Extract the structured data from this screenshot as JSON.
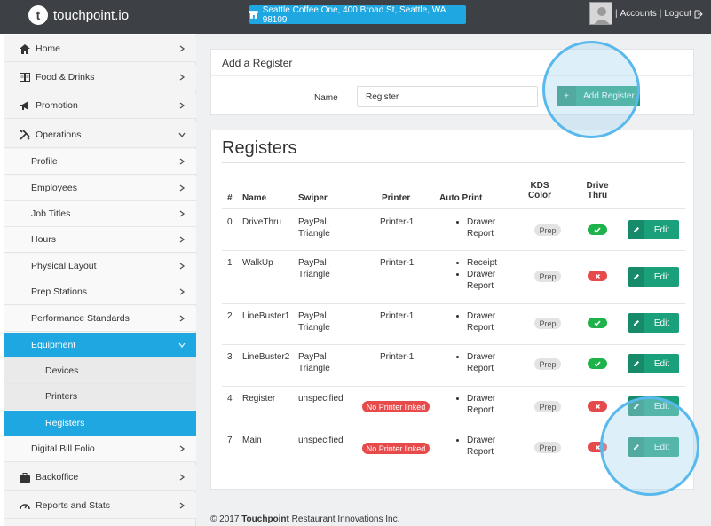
{
  "topbar": {
    "logo_text": "touchpoint.io",
    "logo_letter": "t",
    "store_label": "Seattle Coffee One, 400 Broad St, Seattle, WA 98109",
    "accounts_label": "Accounts",
    "logout_label": "Logout",
    "separator": "|"
  },
  "sidebar": {
    "home": "Home",
    "food": "Food & Drinks",
    "promotion": "Promotion",
    "operations": "Operations",
    "profile": "Profile",
    "employees": "Employees",
    "job_titles": "Job Titles",
    "hours": "Hours",
    "physical_layout": "Physical Layout",
    "prep_stations": "Prep Stations",
    "performance_standards": "Performance Standards",
    "equipment": "Equipment",
    "devices": "Devices",
    "printers": "Printers",
    "registers": "Registers",
    "digital_bill_folio": "Digital Bill Folio",
    "backoffice": "Backoffice",
    "reports": "Reports and Stats"
  },
  "add_register": {
    "heading": "Add a Register",
    "name_label": "Name",
    "name_value": "Register",
    "button_label": "Add Register",
    "plus": "+"
  },
  "registers": {
    "title": "Registers",
    "headers": {
      "num": "#",
      "name": "Name",
      "swiper": "Swiper",
      "printer": "Printer",
      "auto_print": "Auto Print",
      "kds_line1": "KDS",
      "kds_line2": "Color",
      "drive_line1": "Drive",
      "drive_line2": "Thru"
    },
    "rows": [
      {
        "num": "0",
        "name": "DriveThru",
        "swiper_1": "PayPal",
        "swiper_2": "Triangle",
        "printer": "Printer-1",
        "auto_1": "Drawer Report",
        "auto_2": "",
        "kds": "Prep",
        "drive": "on",
        "edit": "Edit"
      },
      {
        "num": "1",
        "name": "WalkUp",
        "swiper_1": "PayPal",
        "swiper_2": "Triangle",
        "printer": "Printer-1",
        "auto_1": "Receipt",
        "auto_2": "Drawer Report",
        "kds": "Prep",
        "drive": "off",
        "edit": "Edit"
      },
      {
        "num": "2",
        "name": "LineBuster1",
        "swiper_1": "PayPal",
        "swiper_2": "Triangle",
        "printer": "Printer-1",
        "auto_1": "Drawer Report",
        "auto_2": "",
        "kds": "Prep",
        "drive": "on",
        "edit": "Edit"
      },
      {
        "num": "3",
        "name": "LineBuster2",
        "swiper_1": "PayPal",
        "swiper_2": "Triangle",
        "printer": "Printer-1",
        "auto_1": "Drawer Report",
        "auto_2": "",
        "kds": "Prep",
        "drive": "on",
        "edit": "Edit"
      },
      {
        "num": "4",
        "name": "Register",
        "swiper_1": "unspecified",
        "swiper_2": "",
        "printer": "No Printer linked",
        "auto_1": "Drawer Report",
        "auto_2": "",
        "kds": "Prep",
        "drive": "off",
        "edit": "Edit"
      },
      {
        "num": "7",
        "name": "Main",
        "swiper_1": "unspecified",
        "swiper_2": "",
        "printer": "No Printer linked",
        "auto_1": "Drawer Report",
        "auto_2": "",
        "kds": "Prep",
        "drive": "off",
        "edit": "Edit"
      }
    ]
  },
  "footer": {
    "prefix": "© 2017",
    "brand": "Touchpoint",
    "suffix": "Restaurant Innovations Inc."
  },
  "colors": {
    "topbar": "#3d4045",
    "accent": "#1ea7e1",
    "success": "#1aa07a",
    "danger": "#e74a4a"
  }
}
